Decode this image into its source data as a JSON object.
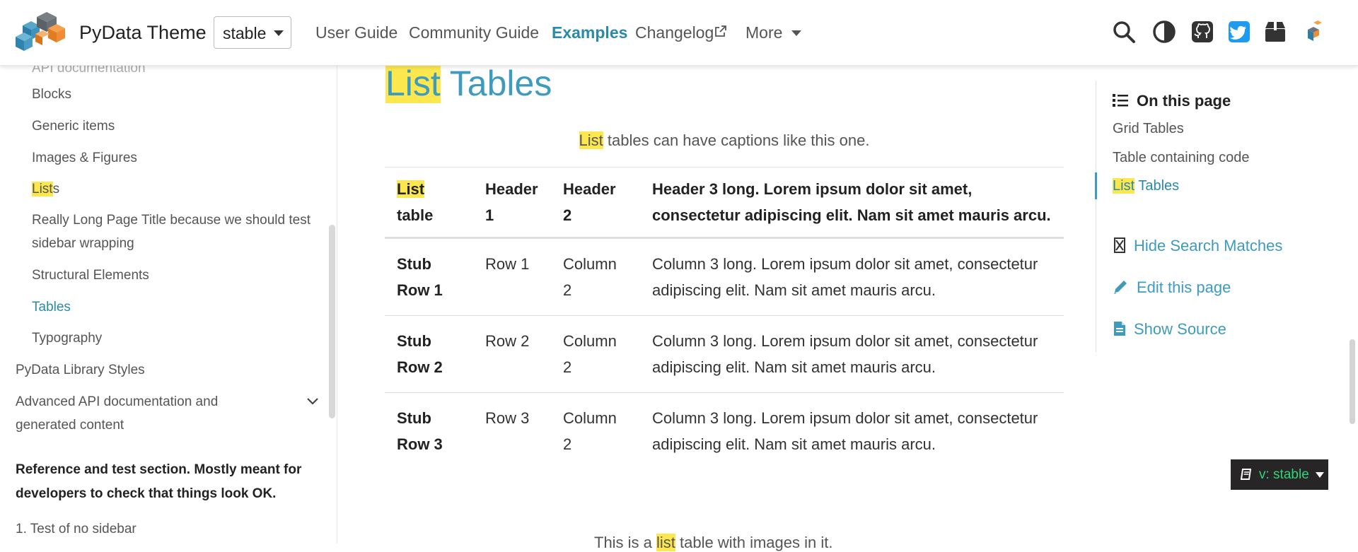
{
  "colors": {
    "accent": "#3e9bbd",
    "highlight": "#fce74f",
    "badge_bg": "#272525",
    "badge_text": "#31d47b"
  },
  "header": {
    "brand": "PyData Theme",
    "version_select": "stable",
    "nav": {
      "user_guide": "User Guide",
      "community_guide": "Community Guide",
      "examples": "Examples",
      "changelog": "Changelog",
      "more": "More"
    },
    "icons": [
      "search-icon",
      "theme-toggle-icon",
      "github-icon",
      "twitter-icon",
      "package-icon",
      "pydata-logo-icon"
    ]
  },
  "sidebar": {
    "partial_top": "API documentation",
    "items": {
      "blocks": "Blocks",
      "generic": "Generic items",
      "images": "Images & Figures",
      "lists_hl": "List",
      "lists_rest": "s",
      "long_title": "Really Long Page Title because we should test sidebar wrapping",
      "structural": "Structural Elements",
      "tables": "Tables",
      "typography": "Typography",
      "library_styles": "PyData Library Styles",
      "advanced_api": "Advanced API documentation and generated content"
    },
    "note": "Reference and test section. Mostly meant for developers to check that things look OK.",
    "no_sidebar": "1. Test of no sidebar"
  },
  "main": {
    "title_hl": "List",
    "title_rest": " Tables",
    "caption_hl": "List",
    "caption_rest": " tables can have captions like this one.",
    "table": {
      "headers": {
        "c0_hl": "List",
        "c0_rest": " table",
        "c1": "Header 1",
        "c2": "Header 2",
        "c3": "Header 3 long. Lorem ipsum dolor sit amet, consectetur adipiscing elit. Nam sit amet mauris arcu."
      },
      "rows": [
        {
          "stub": "Stub Row 1",
          "c1": "Row 1",
          "c2": "Column 2",
          "c3": "Column 3 long. Lorem ipsum dolor sit amet, consectetur adipiscing elit. Nam sit amet mauris arcu."
        },
        {
          "stub": "Stub Row 2",
          "c1": "Row 2",
          "c2": "Column 2",
          "c3": "Column 3 long. Lorem ipsum dolor sit amet, consectetur adipiscing elit. Nam sit amet mauris arcu."
        },
        {
          "stub": "Stub Row 3",
          "c1": "Row 3",
          "c2": "Column 2",
          "c3": "Column 3 long. Lorem ipsum dolor sit amet, consectetur adipiscing elit. Nam sit amet mauris arcu."
        }
      ]
    },
    "after_pre": "This is a ",
    "after_hl": "list",
    "after_rest": " table with images in it."
  },
  "toc": {
    "title": "On this page",
    "links": {
      "grid": "Grid Tables",
      "code": "Table containing code",
      "list_hl": "List",
      "list_rest": " Tables"
    },
    "hide_search": "Hide Search Matches",
    "edit": "Edit this page",
    "source": "Show Source"
  },
  "version_badge": "v: stable"
}
